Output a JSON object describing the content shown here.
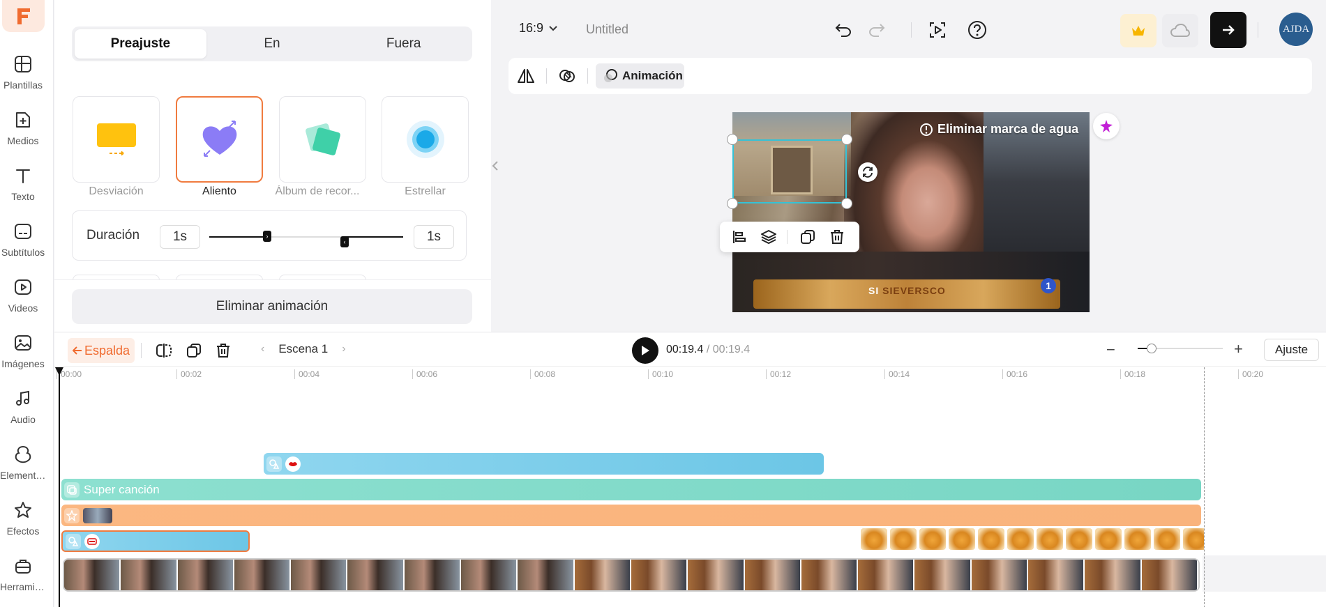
{
  "rail": {
    "items": [
      {
        "label": "Plantillas",
        "icon": "templates-icon"
      },
      {
        "label": "Medios",
        "icon": "media-icon"
      },
      {
        "label": "Texto",
        "icon": "text-icon"
      },
      {
        "label": "Subtítulos",
        "icon": "subtitles-icon"
      },
      {
        "label": "Videos",
        "icon": "videos-icon"
      },
      {
        "label": "Imágenes",
        "icon": "images-icon"
      },
      {
        "label": "Audio",
        "icon": "audio-icon"
      },
      {
        "label": "Elementos",
        "icon": "elements-icon"
      },
      {
        "label": "Efectos",
        "icon": "effects-icon"
      },
      {
        "label": "Herramie...",
        "icon": "tools-icon"
      }
    ],
    "brand_color": "#f06b2f"
  },
  "panel": {
    "tabs": [
      {
        "label": "Preajuste",
        "active": true
      },
      {
        "label": "En",
        "active": false
      },
      {
        "label": "Fuera",
        "active": false
      }
    ],
    "presets": [
      {
        "label": "Desviación",
        "selected": false
      },
      {
        "label": "Aliento",
        "selected": true
      },
      {
        "label": "Álbum de recor...",
        "selected": false
      },
      {
        "label": "Estrellar",
        "selected": false
      }
    ],
    "duration": {
      "label": "Duración",
      "in_value": "1s",
      "out_value": "1s"
    },
    "remove_label": "Eliminar animación"
  },
  "topbar": {
    "ratio": "16:9",
    "title": "Untitled",
    "avatar_text": "AJDA"
  },
  "toolbar": {
    "animation_label": "Animación"
  },
  "canvas": {
    "watermark_label": "Eliminar marca de agua",
    "lower_third_prefix": "SI",
    "lower_third_main": "SIEVERSCO",
    "channel_logo": "1"
  },
  "timeline": {
    "back_label": "Espalda",
    "scene_label": "Escena 1",
    "current_time": "00:19.4",
    "total_time": "/ 00:19.4",
    "fit_label": "Ajuste",
    "ruler": [
      "00:00",
      "00:02",
      "00:04",
      "00:06",
      "00:08",
      "00:10",
      "00:12",
      "00:14",
      "00:16",
      "00:18",
      "00:20"
    ],
    "text_track_label": "Super canción",
    "colors": {
      "sticker_track": "#86d3ea",
      "text_track": "#7fd8c8",
      "effect_track": "#fbb781",
      "selection": "#f07b3f"
    }
  }
}
